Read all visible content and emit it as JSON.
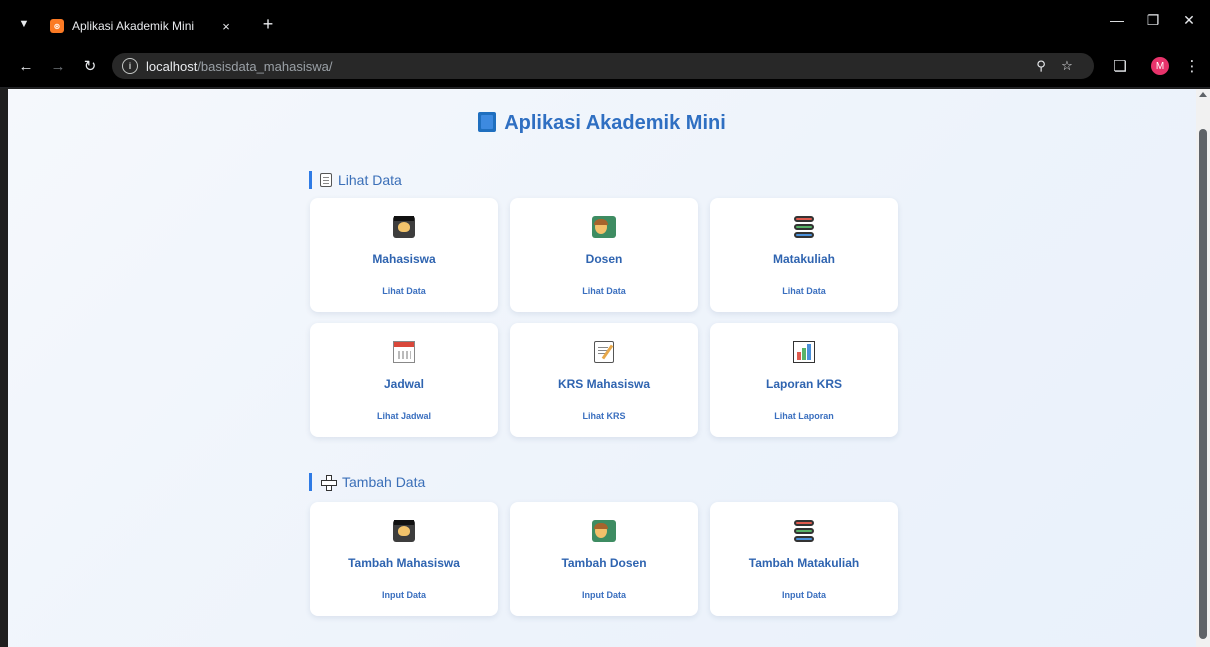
{
  "browser": {
    "tab_title": "Aplikasi Akademik Mini",
    "tab_favicon_text": "XAMPP",
    "new_tab": "+",
    "close": "×",
    "url_host": "localhost",
    "url_path": "/basisdata_mahasiswa/",
    "avatar_letter": "M"
  },
  "page": {
    "title": "Aplikasi Akademik Mini"
  },
  "sections": {
    "view": {
      "label": "Lihat Data",
      "cards": [
        {
          "title": "Mahasiswa",
          "link": "Lihat Data"
        },
        {
          "title": "Dosen",
          "link": "Lihat Data"
        },
        {
          "title": "Matakuliah",
          "link": "Lihat Data"
        },
        {
          "title": "Jadwal",
          "link": "Lihat Jadwal"
        },
        {
          "title": "KRS Mahasiswa",
          "link": "Lihat KRS"
        },
        {
          "title": "Laporan KRS",
          "link": "Lihat Laporan"
        }
      ]
    },
    "add": {
      "label": "Tambah Data",
      "cards": [
        {
          "title": "Tambah Mahasiswa",
          "link": "Input Data"
        },
        {
          "title": "Tambah Dosen",
          "link": "Input Data"
        },
        {
          "title": "Tambah Matakuliah",
          "link": "Input Data"
        }
      ]
    }
  }
}
